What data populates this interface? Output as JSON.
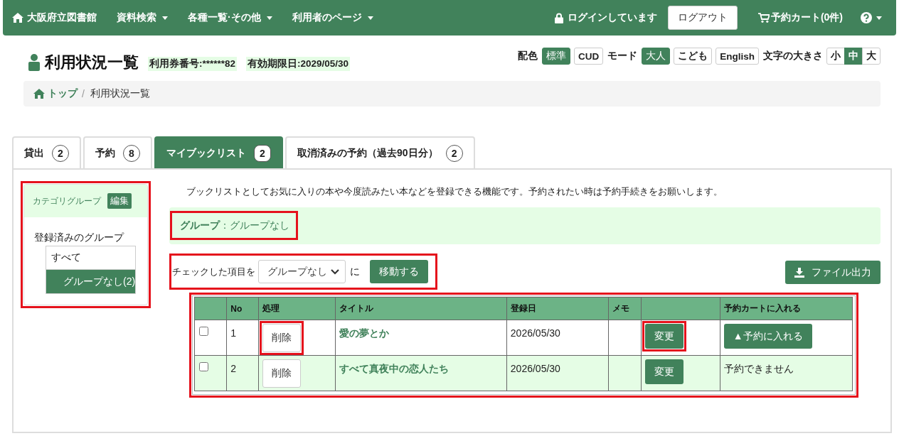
{
  "navbar": {
    "brand": "大阪府立図書館",
    "menus": [
      {
        "label": "資料検索"
      },
      {
        "label": "各種一覧·その他"
      },
      {
        "label": "利用者のページ"
      }
    ],
    "login_status": "ログインしています",
    "logout_button": "ログアウト",
    "cart_link": "予約カート(0件)"
  },
  "page_header": {
    "title": "利用状況一覧",
    "card_number": "利用券番号:******82",
    "expiry": "有効期限日:2029/05/30"
  },
  "display_settings": [
    {
      "label": "配色",
      "kind": "buttons",
      "options": [
        {
          "label": "標準",
          "selected": true
        },
        {
          "label": "CUD",
          "selected": false
        }
      ]
    },
    {
      "label": "モード",
      "kind": "buttons",
      "options": [
        {
          "label": "大人",
          "selected": true
        },
        {
          "label": "こども",
          "selected": false
        },
        {
          "label": "English",
          "selected": false
        }
      ]
    },
    {
      "label": "文字の大きさ",
      "kind": "segmented",
      "options": [
        {
          "label": "小",
          "selected": false
        },
        {
          "label": "中",
          "selected": true
        },
        {
          "label": "大",
          "selected": false
        }
      ]
    }
  ],
  "breadcrumb": [
    {
      "kind": "home",
      "label": "トップ"
    },
    {
      "kind": "separator",
      "label": "/"
    },
    {
      "kind": "current",
      "label": "利用状況一覧"
    }
  ],
  "tabs": [
    {
      "label": "貸出",
      "count": "2",
      "selected": false
    },
    {
      "label": "予約",
      "count": "8",
      "selected": false
    },
    {
      "label": "マイブックリスト",
      "count": "2",
      "selected": true
    },
    {
      "label": "取消済みの予約（過去90日分）",
      "count": "2",
      "selected": false
    }
  ],
  "sidebar": {
    "highlighted": true,
    "header": "カテゴリグループ",
    "edit_button": "編集",
    "groups_label": "登録済みのグループ",
    "groups": [
      {
        "label": "すべて",
        "selected": false
      },
      {
        "label": "グループなし(2)",
        "selected": true
      }
    ]
  },
  "description": "ブックリストとしてお気に入りの本や今度読みたい本などを登録できる機能です。予約されたい時は予約手続きをお願いします。",
  "group_banner": {
    "text": "**グループ**：グループなし",
    "highlighted": true
  },
  "move_bar": {
    "highlighted": true,
    "prefix": "チェックした項目を",
    "select_value": "グループなし",
    "suffix": "に",
    "button": "移動する"
  },
  "export_button": "ファイル出力",
  "table": {
    "highlighted": true,
    "columns": [
      {
        "kind": "blank"
      },
      {
        "kind": "text",
        "label": "No"
      },
      {
        "kind": "text",
        "label": "処理"
      },
      {
        "kind": "text",
        "label": "タイトル"
      },
      {
        "kind": "text",
        "label": "登録日"
      },
      {
        "kind": "text",
        "label": "メモ"
      },
      {
        "kind": "blank"
      },
      {
        "kind": "text",
        "label": "予約カートに入れる"
      }
    ],
    "rows": [
      {
        "checked": false,
        "no": "1",
        "delete": {
          "label": "削除",
          "highlighted": true
        },
        "title": "愛の夢とか",
        "date": "2026/05/30",
        "change": {
          "label": "変更",
          "highlighted": true
        },
        "cart": {
          "kind": "button",
          "label": "▲予約に入れる"
        }
      },
      {
        "checked": false,
        "no": "2",
        "delete": {
          "label": "削除",
          "highlighted": false
        },
        "title": "すべて真夜中の恋人たち",
        "date": "2026/05/30",
        "change": {
          "label": "変更",
          "highlighted": false
        },
        "cart": {
          "kind": "text",
          "label": "予約できません"
        }
      }
    ]
  }
}
